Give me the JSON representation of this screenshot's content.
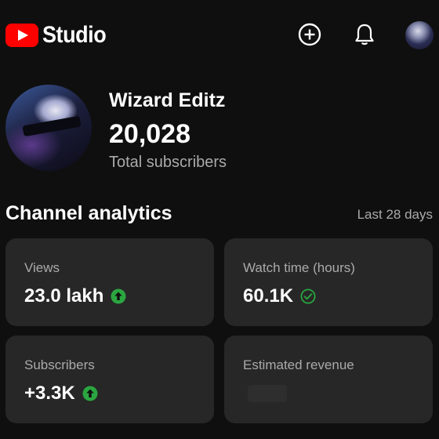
{
  "header": {
    "logo_text": "Studio",
    "icons": [
      "youtube-logo-icon",
      "create-plus-icon",
      "notifications-bell-icon",
      "account-avatar"
    ],
    "accent": "#ff0000"
  },
  "channel": {
    "name": "Wizard Editz",
    "subscriber_count": "20,028",
    "subscriber_label": "Total subscribers"
  },
  "analytics": {
    "title": "Channel analytics",
    "period": "Last 28 days",
    "cards": [
      {
        "label": "Views",
        "value": "23.0 lakh",
        "indicator": "arrow-up-circle-icon",
        "indicator_color": "#2ba640"
      },
      {
        "label": "Watch time (hours)",
        "value": "60.1K",
        "indicator": "check-circle-icon",
        "indicator_color": "#2ba640"
      },
      {
        "label": "Subscribers",
        "value": "+3.3K",
        "indicator": "arrow-up-circle-icon",
        "indicator_color": "#2ba640"
      },
      {
        "label": "Estimated revenue",
        "value": "",
        "indicator": "",
        "indicator_color": ""
      }
    ]
  }
}
